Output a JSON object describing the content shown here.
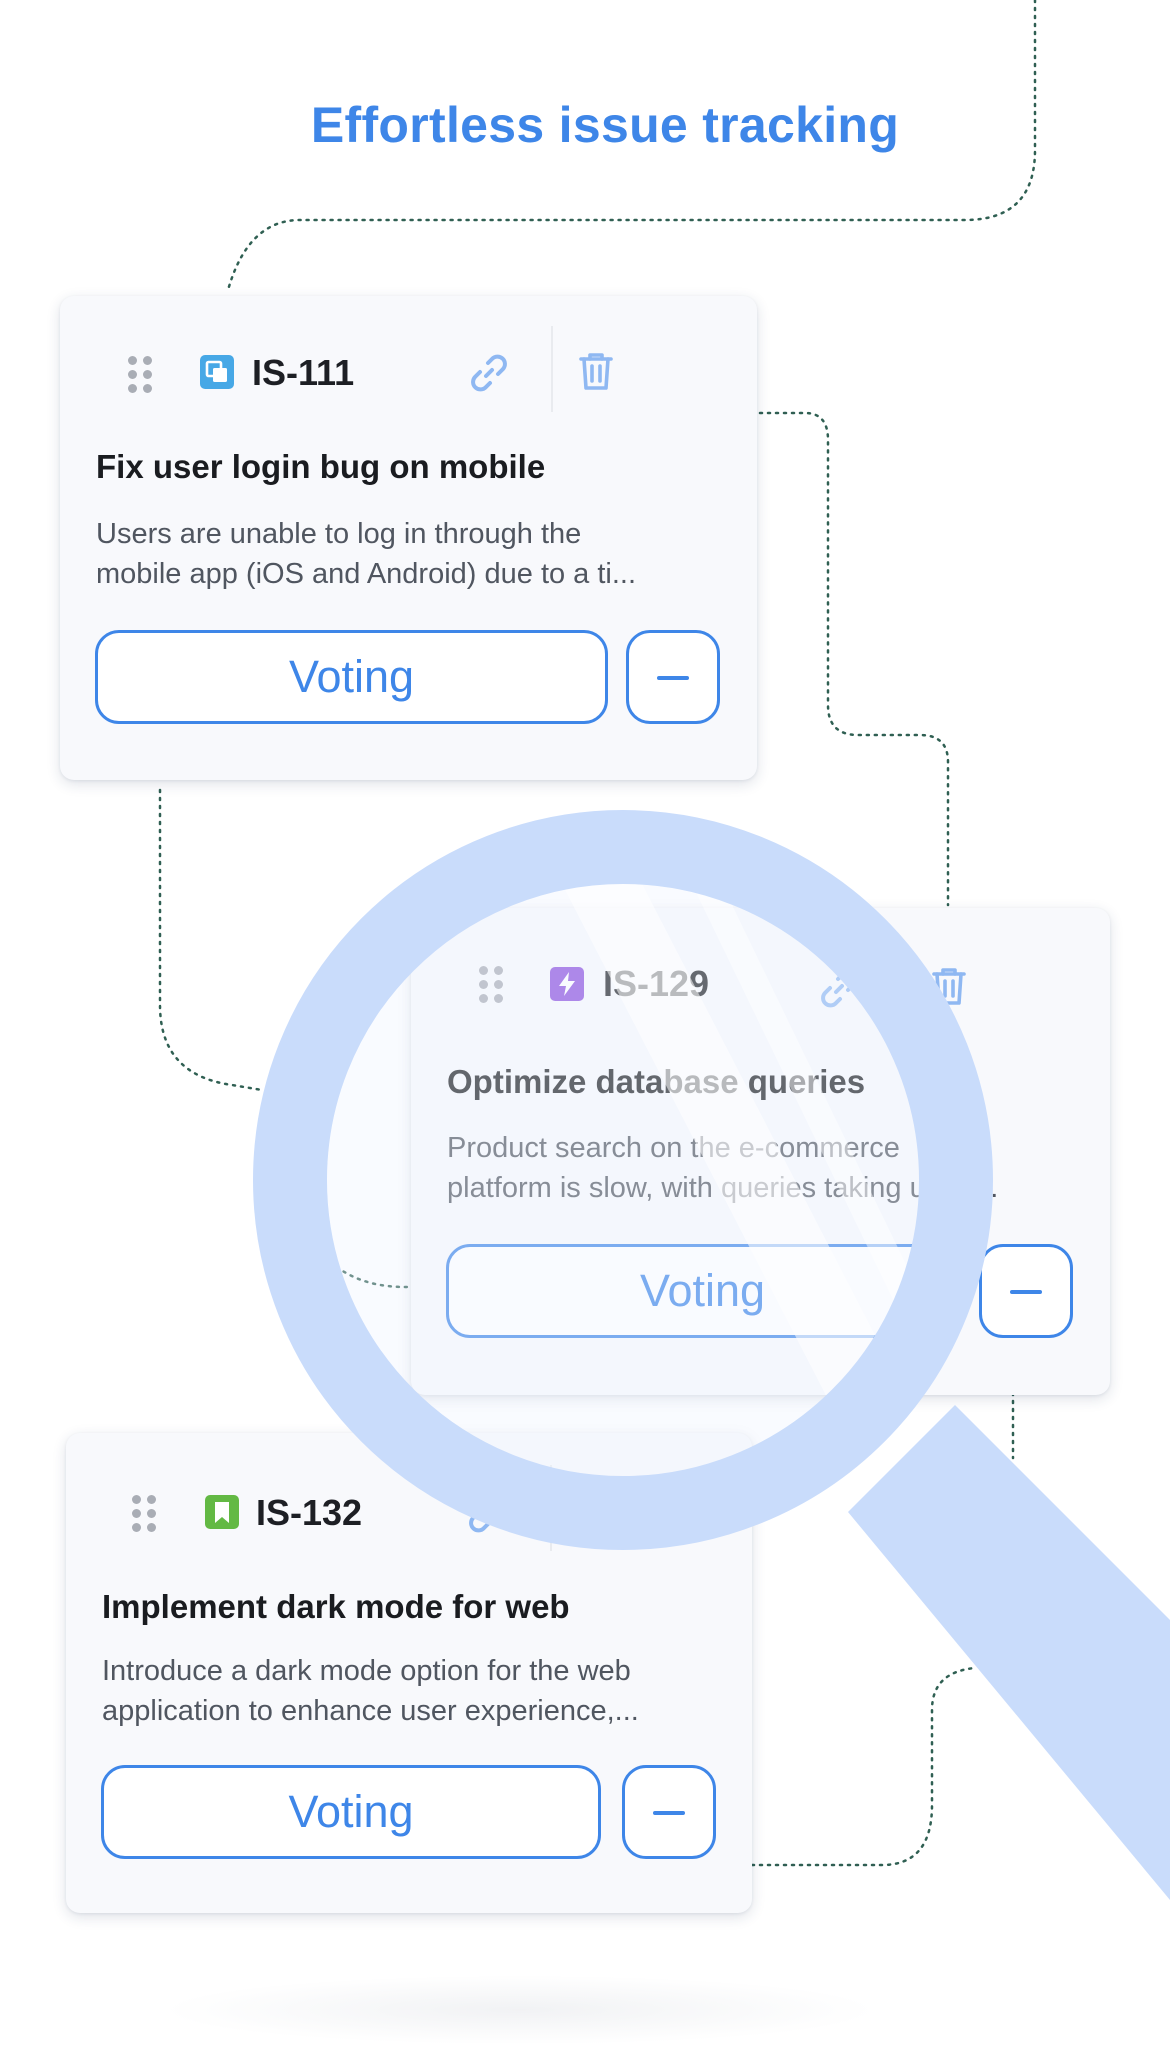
{
  "header": {
    "title": "Effortless issue tracking"
  },
  "cards": [
    {
      "key": "IS-111",
      "type_icon": "copy-icon",
      "type_color": "#47a8e6",
      "title": "Fix user login bug on mobile",
      "description_lines": [
        "Users are unable to log in through the",
        "mobile app (iOS and Android) due to a ti..."
      ],
      "vote_label": "Voting"
    },
    {
      "key": "IS-129",
      "type_icon": "bolt-icon",
      "type_color": "#8a4fdd",
      "title": "Optimize database queries",
      "description_lines": [
        "Product search on the e-commerce",
        "platform is slow, with queries taking up to..."
      ],
      "vote_label": "Voting"
    },
    {
      "key": "IS-132",
      "type_icon": "bookmark-icon",
      "type_color": "#63b944",
      "title": "Implement dark mode for web",
      "description_lines": [
        "Introduce a dark mode option for the web",
        "application to enhance user experience,..."
      ],
      "vote_label": "Voting"
    }
  ],
  "colors": {
    "accent": "#3e86e8",
    "link_icon": "#8fb8f2",
    "connector": "#2f5f52",
    "magnifier": "#c9dcfb"
  }
}
